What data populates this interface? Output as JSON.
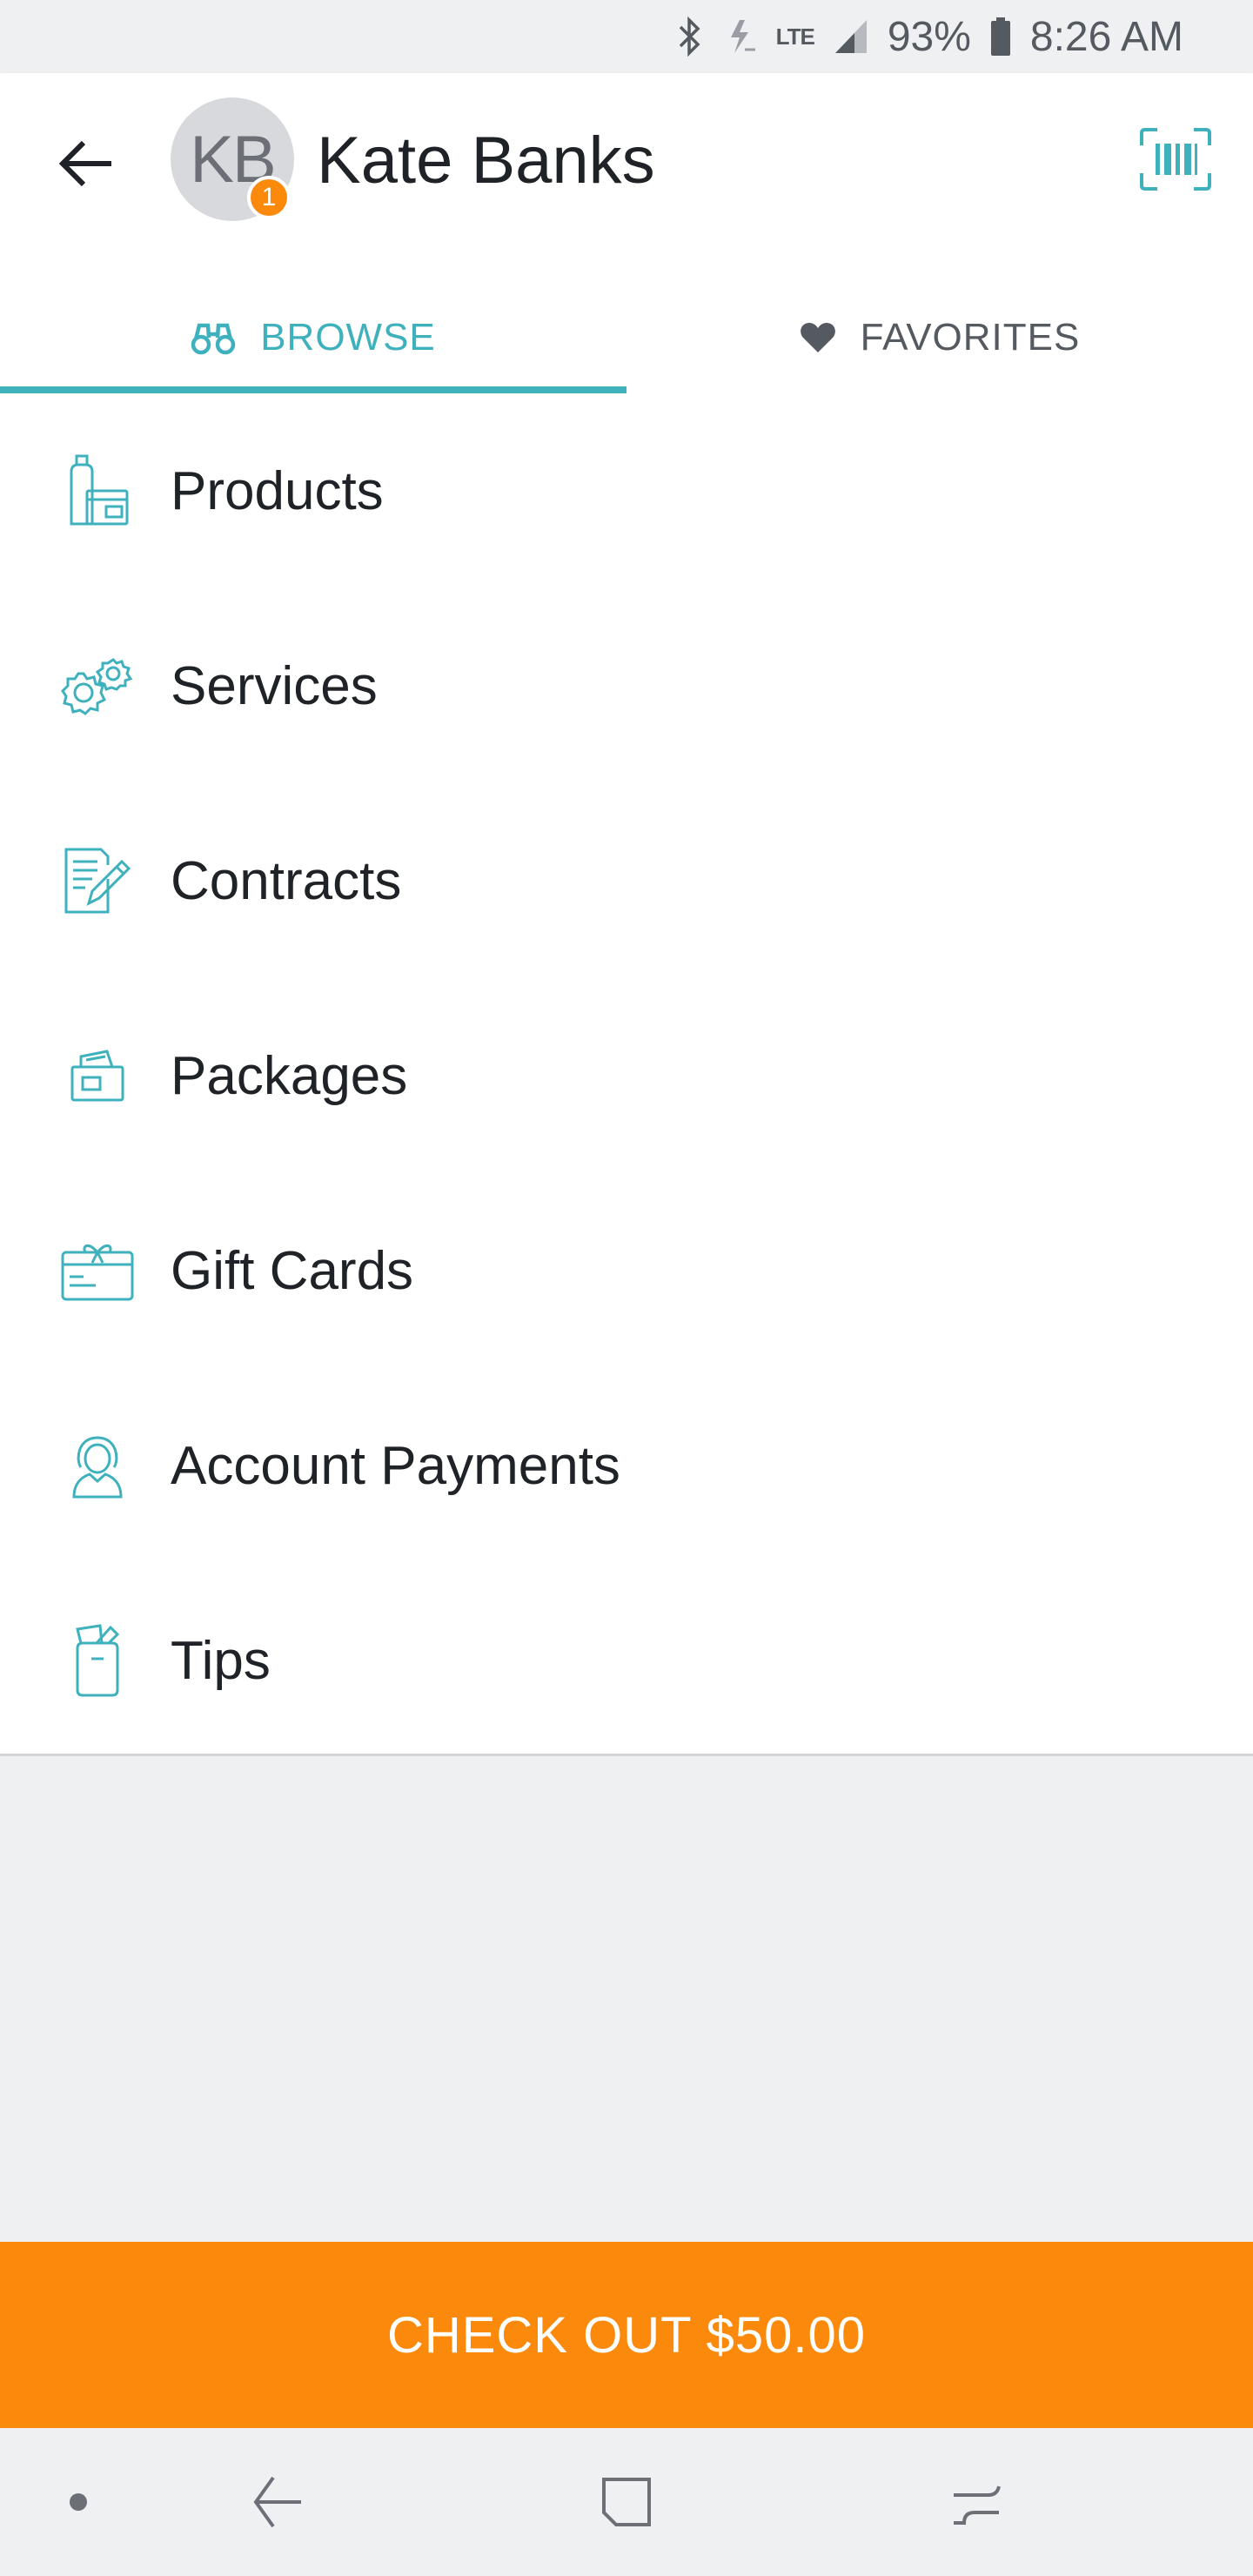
{
  "status_bar": {
    "network": "LTE",
    "battery": "93%",
    "time": "8:26 AM",
    "icons": [
      "bluetooth-icon",
      "data-saver-icon",
      "lte-icon",
      "signal-icon",
      "battery-icon"
    ]
  },
  "header": {
    "avatar_initials": "KB",
    "badge_count": "1",
    "customer_name": "Kate Banks",
    "icons": [
      "back-arrow-icon",
      "barcode-scan-icon"
    ]
  },
  "tabs": [
    {
      "label": "BROWSE",
      "icon": "binoculars-icon",
      "active": true
    },
    {
      "label": "FAVORITES",
      "icon": "heart-icon",
      "active": false
    }
  ],
  "menu": {
    "items": [
      {
        "label": "Products",
        "icon": "products-icon"
      },
      {
        "label": "Services",
        "icon": "gears-icon"
      },
      {
        "label": "Contracts",
        "icon": "contract-edit-icon"
      },
      {
        "label": "Packages",
        "icon": "package-icon"
      },
      {
        "label": "Gift Cards",
        "icon": "gift-card-icon"
      },
      {
        "label": "Account Payments",
        "icon": "account-person-icon"
      },
      {
        "label": "Tips",
        "icon": "tip-jar-icon"
      }
    ]
  },
  "checkout": {
    "label": "CHECK OUT $50.00"
  },
  "nav_bar": {
    "icons": [
      "dot-icon",
      "back-nav-icon",
      "home-nav-icon",
      "recents-nav-icon"
    ]
  },
  "colors": {
    "accent": "#3fb1bd",
    "checkout": "#fb8a0c",
    "background": "#eff0f2",
    "text": "#1f2226"
  }
}
